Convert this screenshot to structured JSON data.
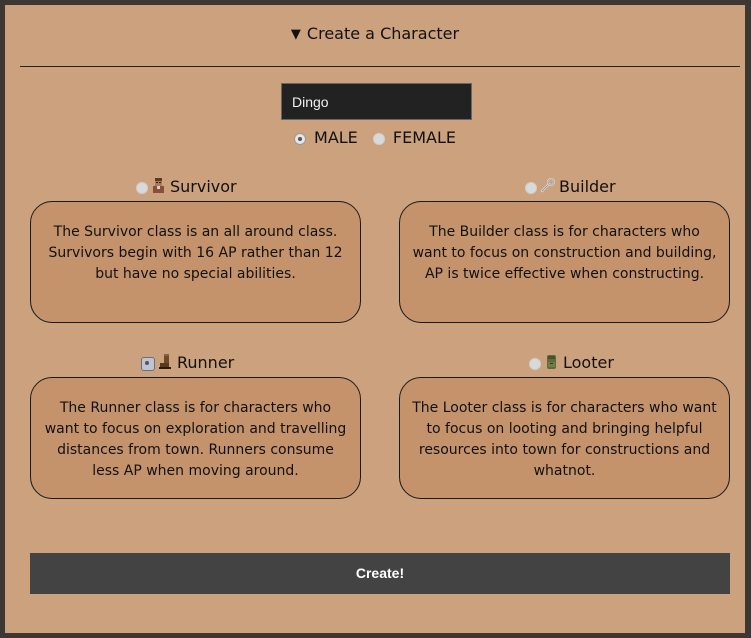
{
  "header": {
    "toggle_icon": "triangle-down-icon",
    "title": "Create a Character"
  },
  "name_field": {
    "value": "Dingo"
  },
  "gender": {
    "options": [
      {
        "label": "MALE",
        "selected": true
      },
      {
        "label": "FEMALE",
        "selected": false
      }
    ]
  },
  "classes": [
    {
      "name": "Survivor",
      "icon": "survivor-icon",
      "selected": false,
      "description": "The Survivor class is an all around class. Survivors begin with 16 AP rather than 12 but have no special abilities."
    },
    {
      "name": "Builder",
      "icon": "wrench-icon",
      "selected": false,
      "description": "The Builder class is for characters who want to focus on construction and building, AP is twice effective when constructing."
    },
    {
      "name": "Runner",
      "icon": "boot-icon",
      "selected": true,
      "description": "The Runner class is for characters who want to focus on exploration and travelling distances from town. Runners consume less AP when moving around."
    },
    {
      "name": "Looter",
      "icon": "backpack-icon",
      "selected": false,
      "description": "The Looter class is for characters who want to focus on looting and bringing helpful resources into town for constructions and whatnot."
    }
  ],
  "create_button": {
    "label": "Create!"
  },
  "colors": {
    "background": "#cca17d",
    "card": "#c5936b",
    "button": "#434343",
    "input": "#222222",
    "frame": "#3c3733"
  }
}
